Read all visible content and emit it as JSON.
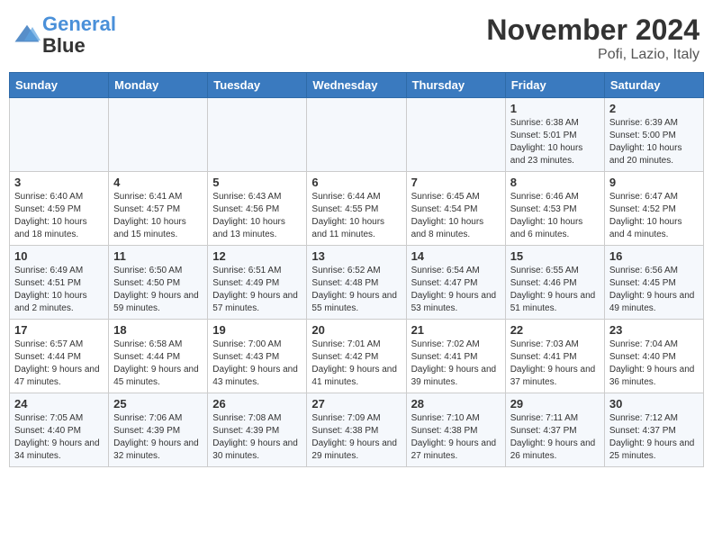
{
  "header": {
    "logo_line1": "General",
    "logo_line2": "Blue",
    "month_title": "November 2024",
    "location": "Pofi, Lazio, Italy"
  },
  "days_of_week": [
    "Sunday",
    "Monday",
    "Tuesday",
    "Wednesday",
    "Thursday",
    "Friday",
    "Saturday"
  ],
  "weeks": [
    [
      {
        "day": "",
        "info": ""
      },
      {
        "day": "",
        "info": ""
      },
      {
        "day": "",
        "info": ""
      },
      {
        "day": "",
        "info": ""
      },
      {
        "day": "",
        "info": ""
      },
      {
        "day": "1",
        "info": "Sunrise: 6:38 AM\nSunset: 5:01 PM\nDaylight: 10 hours and 23 minutes."
      },
      {
        "day": "2",
        "info": "Sunrise: 6:39 AM\nSunset: 5:00 PM\nDaylight: 10 hours and 20 minutes."
      }
    ],
    [
      {
        "day": "3",
        "info": "Sunrise: 6:40 AM\nSunset: 4:59 PM\nDaylight: 10 hours and 18 minutes."
      },
      {
        "day": "4",
        "info": "Sunrise: 6:41 AM\nSunset: 4:57 PM\nDaylight: 10 hours and 15 minutes."
      },
      {
        "day": "5",
        "info": "Sunrise: 6:43 AM\nSunset: 4:56 PM\nDaylight: 10 hours and 13 minutes."
      },
      {
        "day": "6",
        "info": "Sunrise: 6:44 AM\nSunset: 4:55 PM\nDaylight: 10 hours and 11 minutes."
      },
      {
        "day": "7",
        "info": "Sunrise: 6:45 AM\nSunset: 4:54 PM\nDaylight: 10 hours and 8 minutes."
      },
      {
        "day": "8",
        "info": "Sunrise: 6:46 AM\nSunset: 4:53 PM\nDaylight: 10 hours and 6 minutes."
      },
      {
        "day": "9",
        "info": "Sunrise: 6:47 AM\nSunset: 4:52 PM\nDaylight: 10 hours and 4 minutes."
      }
    ],
    [
      {
        "day": "10",
        "info": "Sunrise: 6:49 AM\nSunset: 4:51 PM\nDaylight: 10 hours and 2 minutes."
      },
      {
        "day": "11",
        "info": "Sunrise: 6:50 AM\nSunset: 4:50 PM\nDaylight: 9 hours and 59 minutes."
      },
      {
        "day": "12",
        "info": "Sunrise: 6:51 AM\nSunset: 4:49 PM\nDaylight: 9 hours and 57 minutes."
      },
      {
        "day": "13",
        "info": "Sunrise: 6:52 AM\nSunset: 4:48 PM\nDaylight: 9 hours and 55 minutes."
      },
      {
        "day": "14",
        "info": "Sunrise: 6:54 AM\nSunset: 4:47 PM\nDaylight: 9 hours and 53 minutes."
      },
      {
        "day": "15",
        "info": "Sunrise: 6:55 AM\nSunset: 4:46 PM\nDaylight: 9 hours and 51 minutes."
      },
      {
        "day": "16",
        "info": "Sunrise: 6:56 AM\nSunset: 4:45 PM\nDaylight: 9 hours and 49 minutes."
      }
    ],
    [
      {
        "day": "17",
        "info": "Sunrise: 6:57 AM\nSunset: 4:44 PM\nDaylight: 9 hours and 47 minutes."
      },
      {
        "day": "18",
        "info": "Sunrise: 6:58 AM\nSunset: 4:44 PM\nDaylight: 9 hours and 45 minutes."
      },
      {
        "day": "19",
        "info": "Sunrise: 7:00 AM\nSunset: 4:43 PM\nDaylight: 9 hours and 43 minutes."
      },
      {
        "day": "20",
        "info": "Sunrise: 7:01 AM\nSunset: 4:42 PM\nDaylight: 9 hours and 41 minutes."
      },
      {
        "day": "21",
        "info": "Sunrise: 7:02 AM\nSunset: 4:41 PM\nDaylight: 9 hours and 39 minutes."
      },
      {
        "day": "22",
        "info": "Sunrise: 7:03 AM\nSunset: 4:41 PM\nDaylight: 9 hours and 37 minutes."
      },
      {
        "day": "23",
        "info": "Sunrise: 7:04 AM\nSunset: 4:40 PM\nDaylight: 9 hours and 36 minutes."
      }
    ],
    [
      {
        "day": "24",
        "info": "Sunrise: 7:05 AM\nSunset: 4:40 PM\nDaylight: 9 hours and 34 minutes."
      },
      {
        "day": "25",
        "info": "Sunrise: 7:06 AM\nSunset: 4:39 PM\nDaylight: 9 hours and 32 minutes."
      },
      {
        "day": "26",
        "info": "Sunrise: 7:08 AM\nSunset: 4:39 PM\nDaylight: 9 hours and 30 minutes."
      },
      {
        "day": "27",
        "info": "Sunrise: 7:09 AM\nSunset: 4:38 PM\nDaylight: 9 hours and 29 minutes."
      },
      {
        "day": "28",
        "info": "Sunrise: 7:10 AM\nSunset: 4:38 PM\nDaylight: 9 hours and 27 minutes."
      },
      {
        "day": "29",
        "info": "Sunrise: 7:11 AM\nSunset: 4:37 PM\nDaylight: 9 hours and 26 minutes."
      },
      {
        "day": "30",
        "info": "Sunrise: 7:12 AM\nSunset: 4:37 PM\nDaylight: 9 hours and 25 minutes."
      }
    ]
  ]
}
